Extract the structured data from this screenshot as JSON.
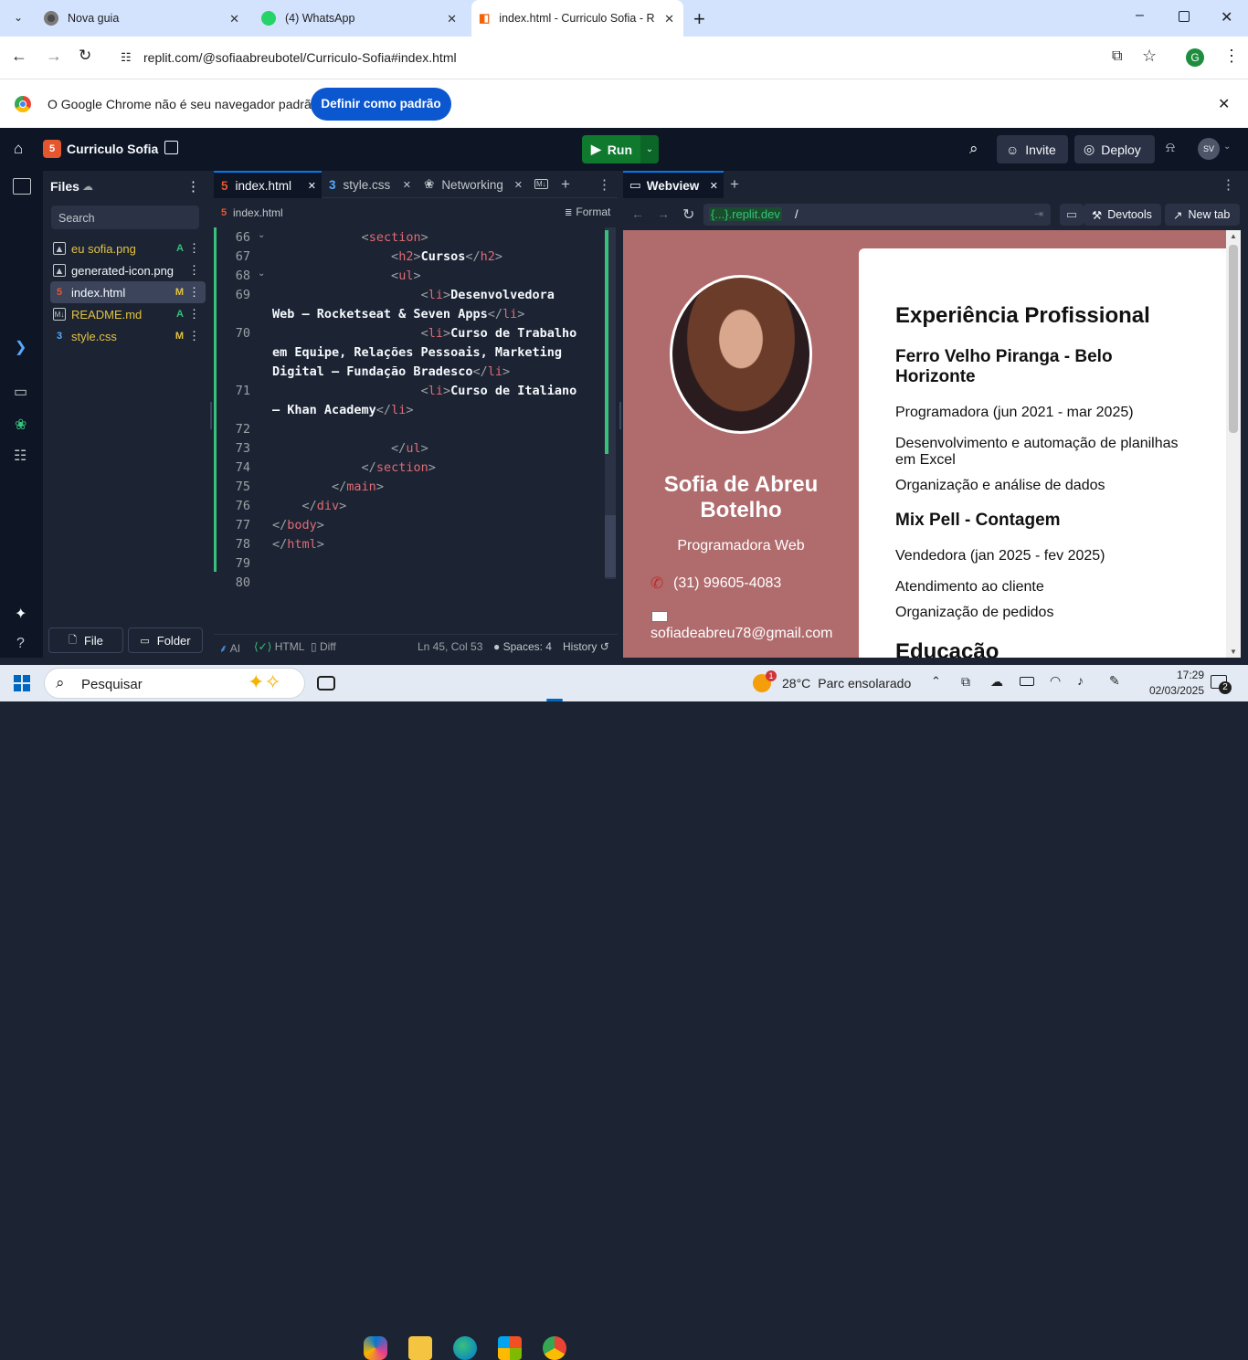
{
  "browser": {
    "tabs": [
      {
        "title": "Nova guia"
      },
      {
        "title": "(4) WhatsApp"
      },
      {
        "title": "index.html - Curriculo Sofia - Re"
      }
    ],
    "url": "replit.com/@sofiaabreubotel/Curriculo-Sofia#index.html",
    "profile_initial": "G",
    "infobar_text": "O Google Chrome não é seu navegador padrão",
    "infobar_button": "Definir como padrão"
  },
  "replit": {
    "project_name": "Curriculo Sofia",
    "run_label": "Run",
    "invite_label": "Invite",
    "deploy_label": "Deploy",
    "avatar": "SV"
  },
  "files": {
    "title": "Files",
    "search_placeholder": "Search",
    "items": [
      {
        "name": "eu sofia.png",
        "badge": "A",
        "color": "#e2c341",
        "icon": "image-icon"
      },
      {
        "name": "generated-icon.png",
        "badge": "",
        "color": "#f5f9fc",
        "icon": "image-icon"
      },
      {
        "name": "index.html",
        "badge": "M",
        "color": "#f5f9fc",
        "icon": "html-icon"
      },
      {
        "name": "README.md",
        "badge": "A",
        "color": "#e2c341",
        "icon": "markdown-icon"
      },
      {
        "name": "style.css",
        "badge": "M",
        "color": "#e2c341",
        "icon": "css-icon"
      }
    ],
    "file_button": "File",
    "folder_button": "Folder"
  },
  "editor": {
    "tabs": [
      {
        "label": "index.html"
      },
      {
        "label": "style.css"
      },
      {
        "label": "Networking"
      }
    ],
    "breadcrumb": "index.html",
    "format_label": "Format",
    "line_numbers": [
      "66",
      "67",
      "68",
      "69",
      "70",
      "71",
      "72",
      "73",
      "74",
      "75",
      "76",
      "77",
      "78",
      "79",
      "80"
    ],
    "status": {
      "ai": "AI",
      "lang": "HTML",
      "diff": "Diff",
      "position": "Ln 45, Col 53",
      "spaces": "Spaces: 4",
      "history": "History"
    }
  },
  "webview": {
    "tab_label": "Webview",
    "url_host": "{...}.replit.dev",
    "url_path": "/",
    "devtools_label": "Devtools",
    "newtab_label": "New tab",
    "resume": {
      "name": "Sofia de Abreu Botelho",
      "role": "Programadora Web",
      "phone": "(31) 99605-4083",
      "email": "sofiadeabreu78@gmail.com",
      "experience_title": "Experiência Profissional",
      "job1_title": "Ferro Velho Piranga - Belo Horizonte",
      "job1_role": "Programadora (jun 2021 - mar 2025)",
      "job1_item1": "Desenvolvimento e automação de planilhas em Excel",
      "job1_item2": "Organização e análise de dados",
      "job2_title": "Mix Pell - Contagem",
      "job2_role": "Vendedora (jan 2025 - fev 2025)",
      "job2_item1": "Atendimento ao cliente",
      "job2_item2": "Organização de pedidos",
      "education_title": "Educação"
    }
  },
  "taskbar": {
    "search_placeholder": "Pesquisar",
    "weather_temp": "28°C",
    "weather_text": "Parc ensolarado",
    "weather_badge": "1",
    "time": "17:29",
    "date": "02/03/2025",
    "notif_count": "2"
  },
  "colors": {
    "replit_bg": "#1c2333",
    "run_green": "#0f7a2e",
    "accent_blue": "#0b57d0",
    "resume_side": "#b06b6d"
  }
}
